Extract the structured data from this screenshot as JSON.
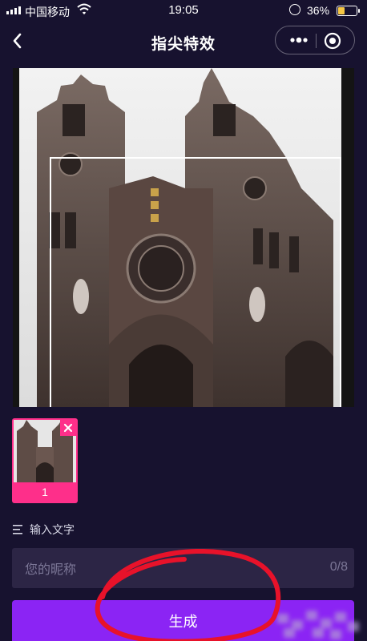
{
  "status_bar": {
    "carrier": "中国移动",
    "time": "19:05",
    "battery_percent": "36%",
    "battery_level": 0.36,
    "battery_color": "#f6c744"
  },
  "nav": {
    "title": "指尖特效",
    "back_icon": "chevron-left-icon",
    "more_icon": "more-dots-icon",
    "close_icon": "target-circle-icon"
  },
  "thumbnail": {
    "index": "1",
    "accent": "#fe2f8a"
  },
  "text_input": {
    "section_label": "输入文字",
    "placeholder": "您的昵称",
    "counter": "0/8",
    "value": ""
  },
  "generate_button": {
    "label": "生成",
    "color": "#8b24f4"
  },
  "colors": {
    "background": "#17122f",
    "input_bg": "#2c2545",
    "annotation": "#e8122a"
  }
}
